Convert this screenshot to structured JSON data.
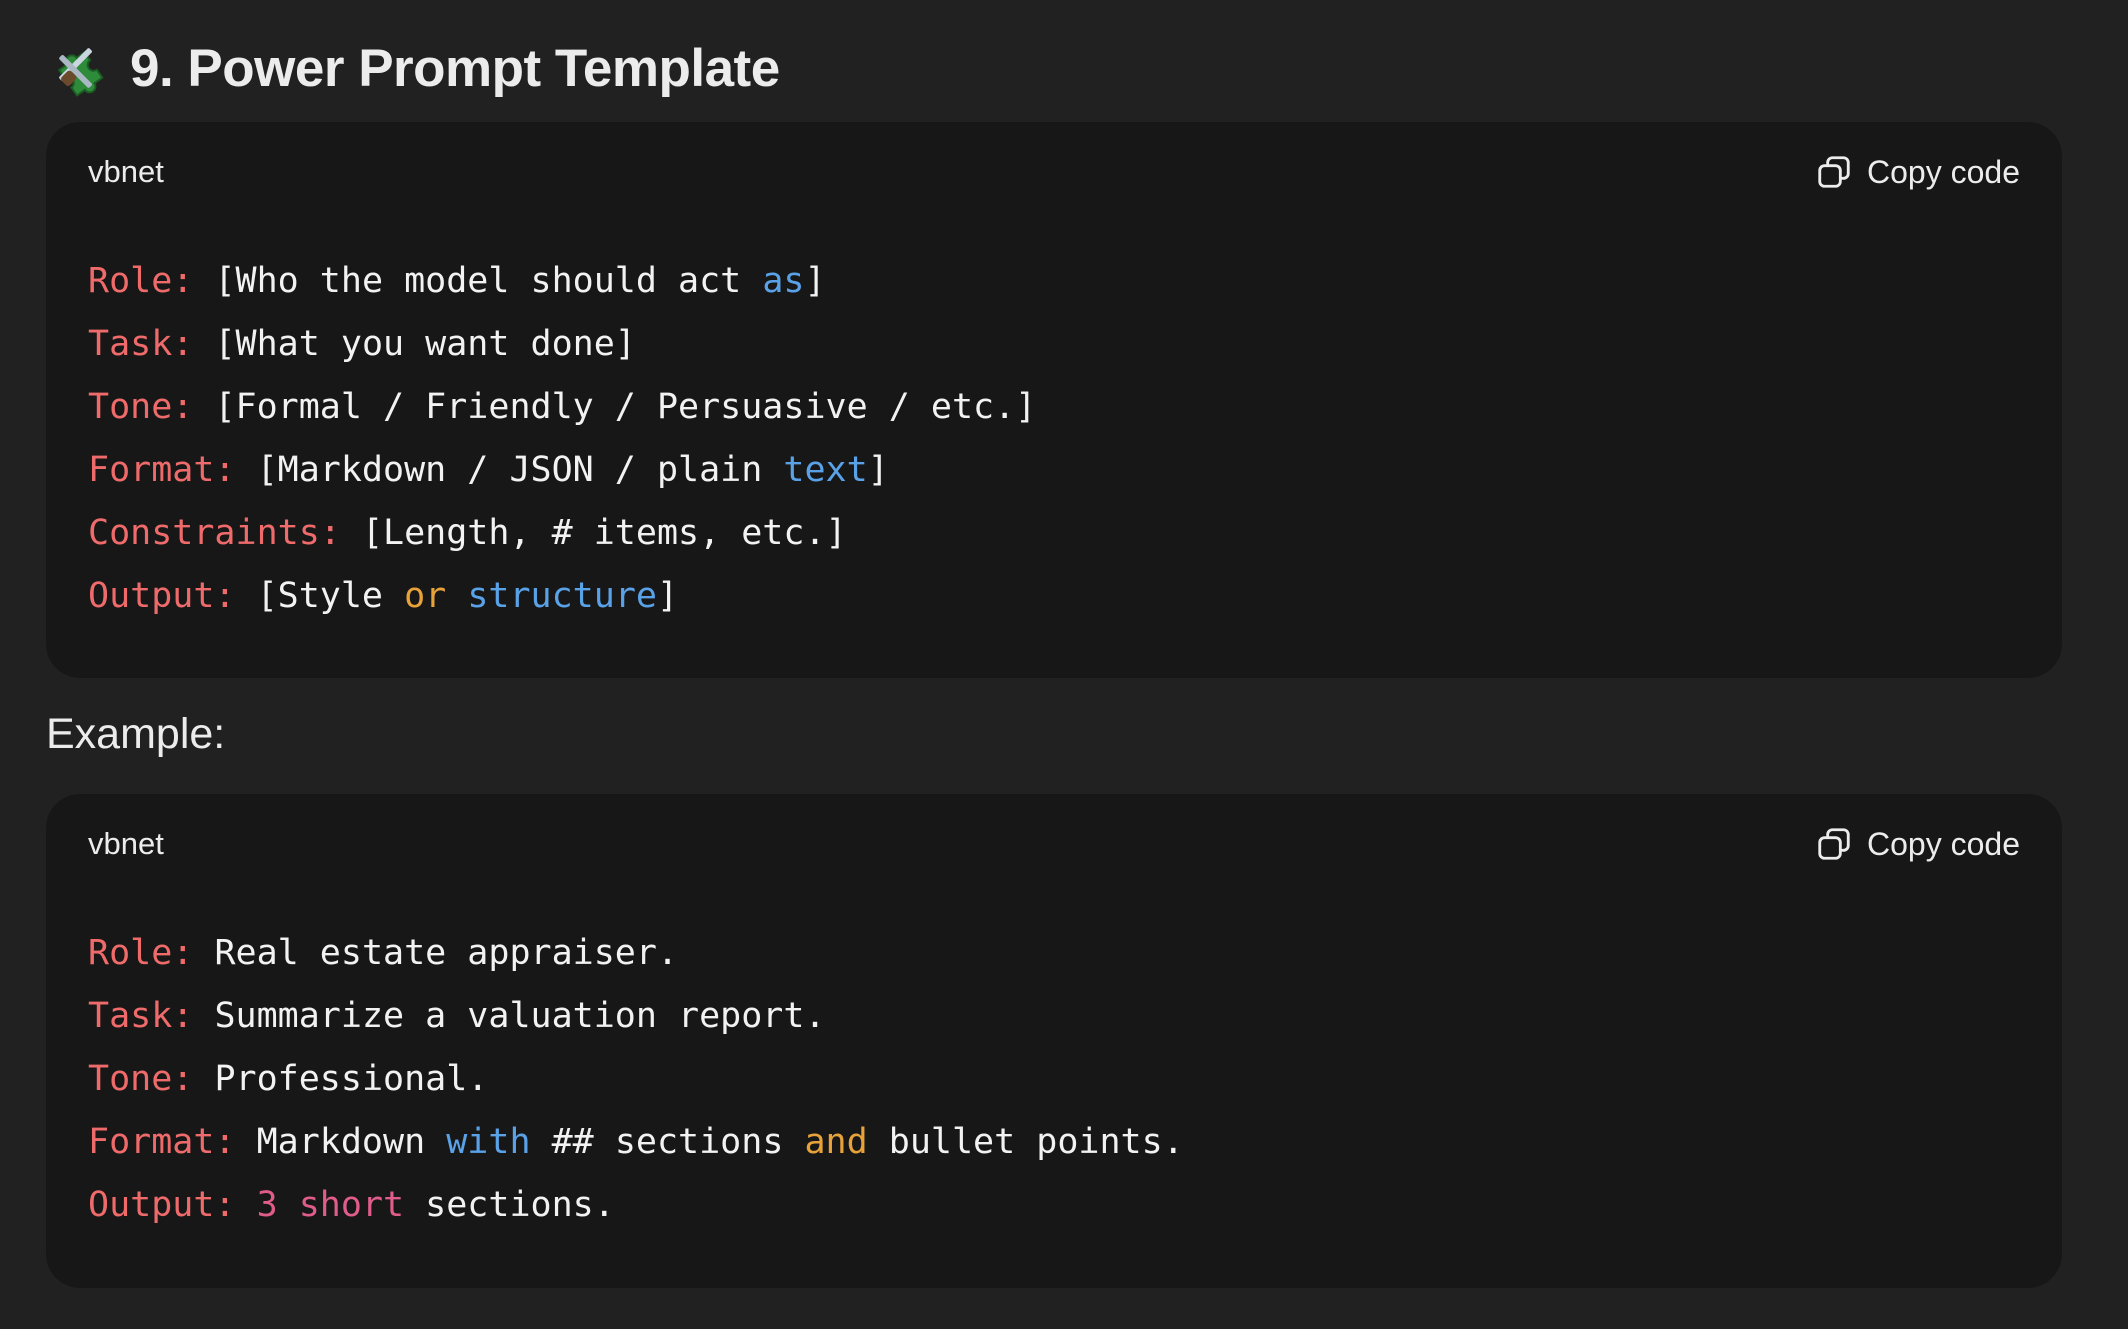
{
  "heading": {
    "icon": "puzzle-piece-icon",
    "text": "9. Power Prompt Template"
  },
  "blocks": [
    {
      "language": "vbnet",
      "copy_label": "Copy code",
      "lines": [
        [
          {
            "t": "Role: ",
            "c": "key"
          },
          {
            "t": "[Who the model should act ",
            "c": "plain"
          },
          {
            "t": "as",
            "c": "kw"
          },
          {
            "t": "]",
            "c": "plain"
          }
        ],
        [
          {
            "t": "Task: ",
            "c": "key"
          },
          {
            "t": "[What you want done]",
            "c": "plain"
          }
        ],
        [
          {
            "t": "Tone: ",
            "c": "key"
          },
          {
            "t": "[Formal / Friendly / Persuasive / etc.]",
            "c": "plain"
          }
        ],
        [
          {
            "t": "Format: ",
            "c": "key"
          },
          {
            "t": "[Markdown / JSON / plain ",
            "c": "plain"
          },
          {
            "t": "text",
            "c": "kw"
          },
          {
            "t": "]",
            "c": "plain"
          }
        ],
        [
          {
            "t": "Constraints: ",
            "c": "key"
          },
          {
            "t": "[Length, # items, etc.]",
            "c": "plain"
          }
        ],
        [
          {
            "t": "Output: ",
            "c": "key"
          },
          {
            "t": "[Style ",
            "c": "plain"
          },
          {
            "t": "or",
            "c": "or"
          },
          {
            "t": " ",
            "c": "plain"
          },
          {
            "t": "structure",
            "c": "kw"
          },
          {
            "t": "]",
            "c": "plain"
          }
        ]
      ]
    },
    {
      "language": "vbnet",
      "copy_label": "Copy code",
      "lines": [
        [
          {
            "t": "Role: ",
            "c": "key"
          },
          {
            "t": "Real estate appraiser.",
            "c": "plain"
          }
        ],
        [
          {
            "t": "Task: ",
            "c": "key"
          },
          {
            "t": "Summarize a valuation report.",
            "c": "plain"
          }
        ],
        [
          {
            "t": "Tone: ",
            "c": "key"
          },
          {
            "t": "Professional.",
            "c": "plain"
          }
        ],
        [
          {
            "t": "Format: ",
            "c": "key"
          },
          {
            "t": "Markdown ",
            "c": "plain"
          },
          {
            "t": "with",
            "c": "kw"
          },
          {
            "t": " ## sections ",
            "c": "plain"
          },
          {
            "t": "and",
            "c": "or"
          },
          {
            "t": " bullet points.",
            "c": "plain"
          }
        ],
        [
          {
            "t": "Output: ",
            "c": "key"
          },
          {
            "t": "3",
            "c": "num"
          },
          {
            "t": " ",
            "c": "plain"
          },
          {
            "t": "short",
            "c": "num"
          },
          {
            "t": " sections.",
            "c": "plain"
          }
        ]
      ]
    }
  ],
  "example_label": "Example:",
  "colors": {
    "background": "#212121",
    "code_background": "#171717",
    "key": "#ef6b6b",
    "keyword": "#5aa2e8",
    "operator": "#e7a23a",
    "number": "#e05c8a",
    "text": "#f2f2f2"
  }
}
